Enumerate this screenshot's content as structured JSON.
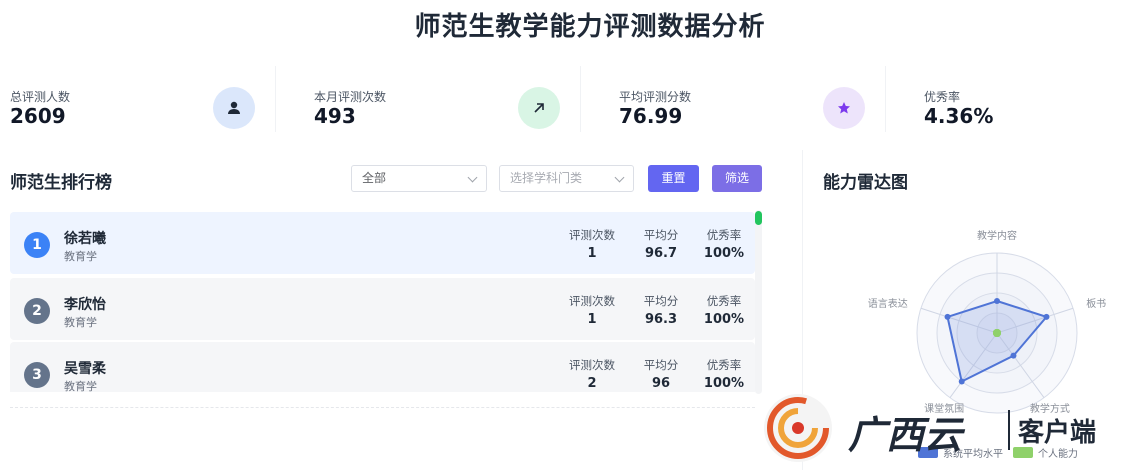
{
  "page": {
    "title": "师范生教学能力评测数据分析"
  },
  "stats": [
    {
      "label": "总评测人数",
      "value": "2609",
      "icon": "user-icon",
      "icon_bg": "#dbe7fb",
      "icon_color": "#1f2937"
    },
    {
      "label": "本月评测次数",
      "value": "493",
      "icon": "trend-arrow-icon",
      "icon_bg": "#d9f5e5",
      "icon_color": "#1f2937"
    },
    {
      "label": "平均评测分数",
      "value": "76.99",
      "icon": "star-icon",
      "icon_bg": "#ede4fb",
      "icon_color": "#7c3aed"
    },
    {
      "label": "优秀率",
      "value": "4.36%"
    }
  ],
  "ranking": {
    "title": "师范生排行榜",
    "filter_all": "全部",
    "subject_placeholder": "选择学科门类",
    "reset_label": "重置",
    "filter_label": "筛选",
    "metric_labels": {
      "count": "评测次数",
      "avg": "平均分",
      "excellent": "优秀率"
    },
    "rows": [
      {
        "rank": "1",
        "name": "徐若曦",
        "major": "教育学",
        "count": "1",
        "avg": "96.7",
        "excellent": "100%",
        "badge_color": "#3b82f6",
        "row_bg": "#eef4ff"
      },
      {
        "rank": "2",
        "name": "李欣怡",
        "major": "教育学",
        "count": "1",
        "avg": "96.3",
        "excellent": "100%",
        "badge_color": "#64748b",
        "row_bg": "#f5f6f8"
      },
      {
        "rank": "3",
        "name": "吴雪柔",
        "major": "教育学",
        "count": "2",
        "avg": "96",
        "excellent": "100%",
        "badge_color": "#64748b",
        "row_bg": "#f5f6f8"
      }
    ]
  },
  "radar": {
    "title": "能力雷达图",
    "chart_data": {
      "type": "radar",
      "axes": [
        "教学内容",
        "板书",
        "教学方式",
        "课堂氛围",
        "语言表达"
      ],
      "series": [
        {
          "name": "系统平均水平",
          "values": [
            0.4,
            0.65,
            0.35,
            0.75,
            0.65
          ],
          "color": "#4f74d6"
        },
        {
          "name": "个人能力",
          "values": [
            0,
            0,
            0,
            0,
            0
          ],
          "color": "#8fd16a"
        }
      ],
      "max": 1
    },
    "legend": [
      {
        "label": "系统平均水平",
        "color": "#4f74d6"
      },
      {
        "label": "个人能力",
        "color": "#8fd16a"
      }
    ]
  },
  "watermark": {
    "brand": "广西云",
    "suffix": "客户端"
  }
}
